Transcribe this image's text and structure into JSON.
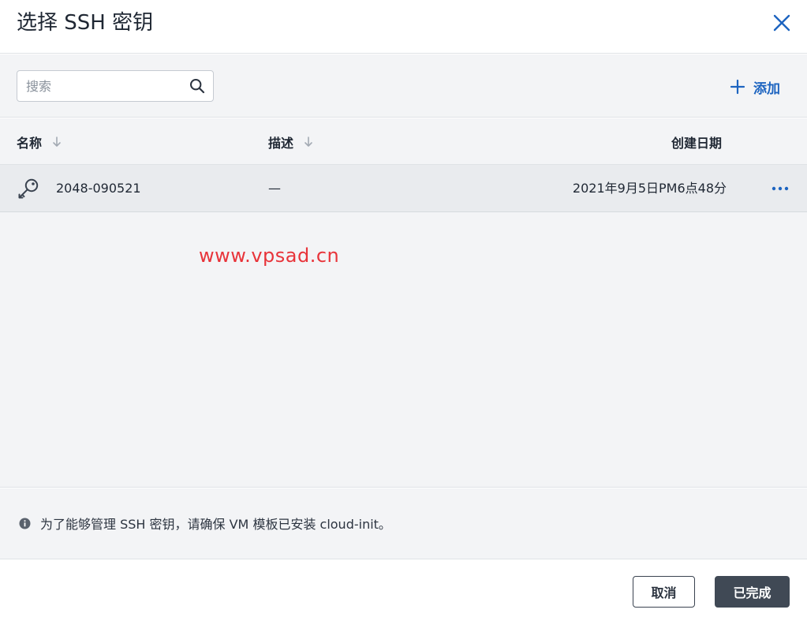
{
  "dialog": {
    "title": "选择 SSH 密钥",
    "close_icon": "close-icon"
  },
  "toolbar": {
    "search_placeholder": "搜索",
    "search_value": "",
    "add_label": "添加"
  },
  "table": {
    "columns": [
      {
        "label": "名称",
        "sortable": true
      },
      {
        "label": "描述",
        "sortable": true
      },
      {
        "label": "创建日期",
        "sortable": false
      }
    ],
    "rows": [
      {
        "icon": "key-icon",
        "name": "2048-090521",
        "description": "—",
        "created": "2021年9月5日PM6点48分",
        "actions_icon": "more-icon"
      }
    ]
  },
  "watermark": "www.vpsad.cn",
  "info": {
    "icon": "info-icon",
    "text": "为了能够管理 SSH 密钥，请确保 VM 模板已安装 cloud-init。"
  },
  "footer": {
    "cancel_label": "取消",
    "done_label": "已完成"
  },
  "colors": {
    "accent": "#1d64c0",
    "primary_button": "#404955",
    "background": "#f3f4f6",
    "selected_row": "#e9ebee",
    "watermark": "#e8343a"
  }
}
